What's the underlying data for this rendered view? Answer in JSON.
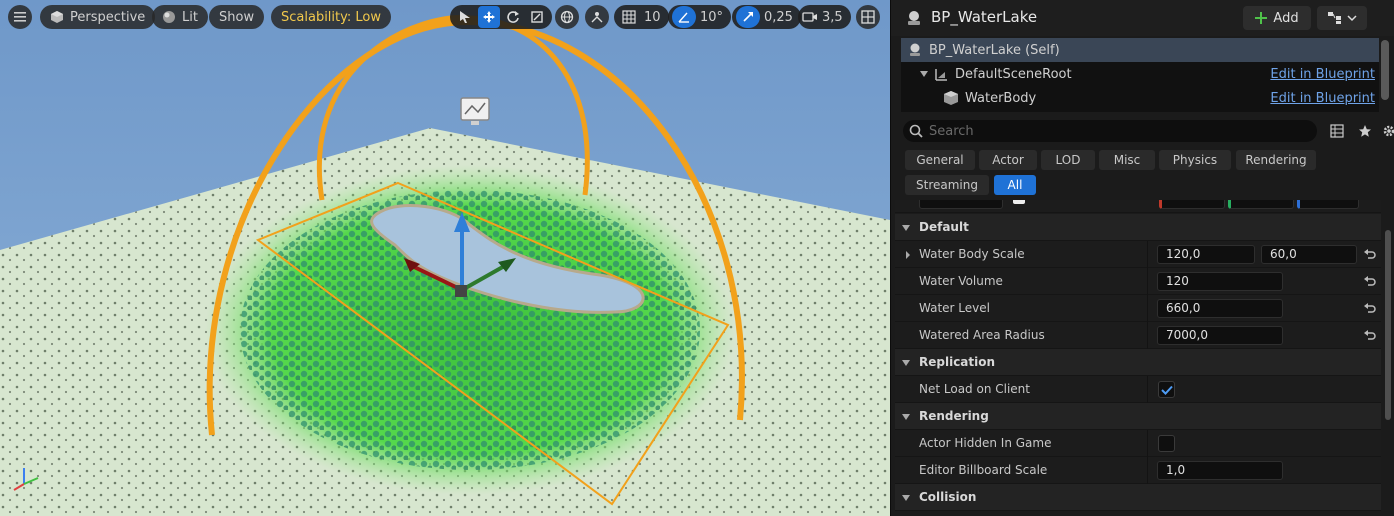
{
  "viewport": {
    "perspective_label": "Perspective",
    "lit_label": "Lit",
    "show_label": "Show",
    "scalability_label": "Scalability: Low",
    "grid_snap_value": "10",
    "rotation_snap_value": "10°",
    "scale_snap_value": "0,25",
    "camera_speed_value": "3,5",
    "colors": {
      "sky": "#7ea4cf",
      "ground": "#d7e6cf",
      "grass": "#4fd34a",
      "water": "#a8c3dc",
      "bounds": "#f2a11b"
    }
  },
  "details": {
    "title": "BP_WaterLake",
    "add_label": "Add",
    "components": [
      {
        "label": "BP_WaterLake (Self)",
        "link": ""
      },
      {
        "label": "DefaultSceneRoot",
        "link": "Edit in Blueprint"
      },
      {
        "label": "WaterBody",
        "link": "Edit in Blueprint"
      }
    ],
    "search_placeholder": "Search",
    "filter_tabs": [
      "General",
      "Actor",
      "LOD",
      "Misc",
      "Physics",
      "Rendering",
      "Streaming",
      "All"
    ],
    "active_filter": "All",
    "sections": {
      "default": "Default",
      "replication": "Replication",
      "rendering": "Rendering",
      "collision": "Collision"
    },
    "properties": {
      "water_body_scale": {
        "label": "Water Body Scale",
        "x": "120,0",
        "y": "60,0"
      },
      "water_volume": {
        "label": "Water Volume",
        "value": "120"
      },
      "water_level": {
        "label": "Water Level",
        "value": "660,0"
      },
      "watered_area_radius": {
        "label": "Watered Area Radius",
        "value": "7000,0"
      },
      "net_load_on_client": {
        "label": "Net Load on Client",
        "checked": true
      },
      "actor_hidden_in_game": {
        "label": "Actor Hidden In Game",
        "checked": false
      },
      "editor_billboard_scale": {
        "label": "Editor Billboard Scale",
        "value": "1,0"
      }
    }
  }
}
